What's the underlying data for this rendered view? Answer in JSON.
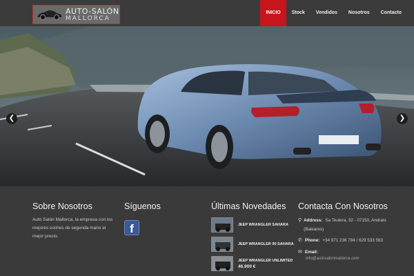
{
  "logo": {
    "line1": "AUTO-SALÓN",
    "line2": "MALLORCA"
  },
  "nav": [
    {
      "label": "INICIO",
      "active": true
    },
    {
      "label": "Stock"
    },
    {
      "label": "Vendidos"
    },
    {
      "label": "Nosotros"
    },
    {
      "label": "Contacto"
    }
  ],
  "hero": {
    "prev_icon": "chevron-left-icon",
    "next_icon": "chevron-right-icon"
  },
  "footer": {
    "about": {
      "title": "Sobre Nosotros",
      "text": "Auto Salón Mallorca, la empresa con los mejores coches de segunda mano al mejor precio."
    },
    "follow": {
      "title": "Síguenos",
      "icon": "facebook-icon"
    },
    "news": {
      "title": "Últimas Novedades",
      "items": [
        {
          "title": "JEEP WRANGLER SAHARA",
          "price": ""
        },
        {
          "title": "JEEP WRANGLER 90 SAHARA",
          "price": ""
        },
        {
          "title": "JEEP WRANGLER UNLIMITED",
          "price": "46.900 €"
        }
      ]
    },
    "contact": {
      "title": "Contacta Con Nosotros",
      "address_label": "Address:",
      "address_value": "Sa Teulera, 32 - 07150, Andratx (Baleares)",
      "phone_label": "Phone:",
      "phone_value": "+34 971 236 784 / 629 533 563",
      "email_label": "Email:",
      "email_value": "info@autosalonmallorca.com"
    }
  },
  "colors": {
    "accent": "#c8141b",
    "header_bg": "#3b3b3b",
    "footer_bg": "#3a3a3a"
  }
}
